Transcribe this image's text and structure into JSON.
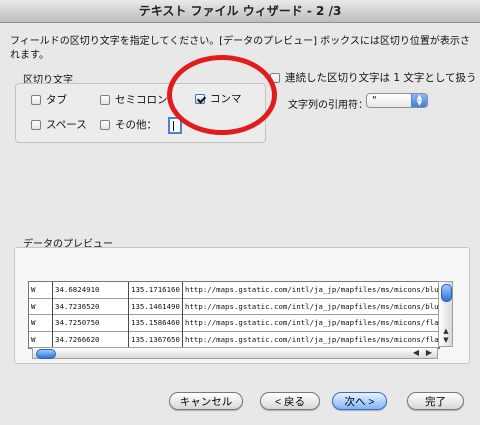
{
  "window": {
    "title": "テキスト ファイル ウィザード - 2 /3"
  },
  "instruction": "フィールドの区切り文字を指定してください。[データのプレビュー] ボックスには区切り位置が表示されます。",
  "delimiters": {
    "title": "区切り文字",
    "tab": "タブ",
    "semicolon": "セミコロン",
    "comma": "コンマ",
    "space": "スペース",
    "other": "その他：",
    "other_value": ""
  },
  "options": {
    "consecutive": "連続した区切り文字は 1 文字として扱う",
    "quote_label": "文字列の引用符：",
    "quote_value": "\""
  },
  "preview": {
    "title": "データのプレビュー",
    "rows": [
      [
        "W",
        "34.6824910",
        "135.1716160",
        "http://maps.gstatic.com/intl/ja_jp/mapfiles/ms/micons/blue-dot."
      ],
      [
        "W",
        "34.7236520",
        "135.1461490",
        "http://maps.gstatic.com/intl/ja_jp/mapfiles/ms/micons/blue-dot."
      ],
      [
        "W",
        "34.7250750",
        "135.1586460",
        "http://maps.gstatic.com/intl/ja_jp/mapfiles/ms/micons/flag.png"
      ],
      [
        "W",
        "34.7266620",
        "135.1367650",
        "http://maps.gstatic.com/intl/ja_jp/mapfiles/ms/micons/flag.png"
      ]
    ]
  },
  "buttons": {
    "cancel": "キャンセル",
    "back": "< 戻る",
    "next": "次へ >",
    "finish": "完了"
  },
  "icons": {
    "dropdown": "up-down-arrows-icon",
    "scroll_up": "scroll-up-arrow-icon",
    "scroll_down": "scroll-down-arrow-icon",
    "scroll_left": "scroll-left-arrow-icon",
    "scroll_right": "scroll-right-arrow-icon"
  },
  "colors": {
    "annotation": "#e21b1b",
    "accent": "#2d72d9"
  }
}
